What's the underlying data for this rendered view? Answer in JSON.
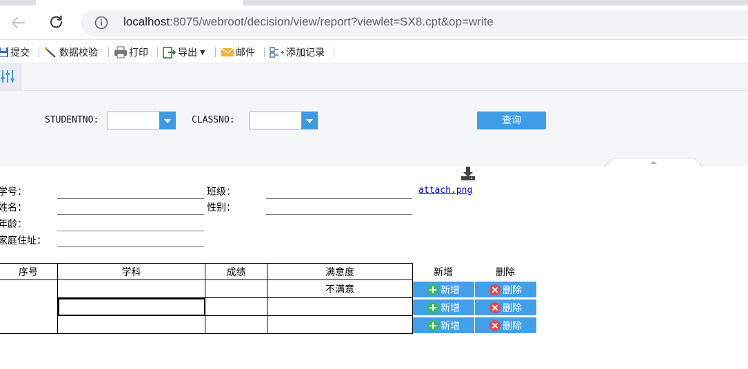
{
  "browser": {
    "url_host": "localhost",
    "url_path": ":8075/webroot/decision/view/report?viewlet=SX8.cpt&op=write"
  },
  "toolbar": {
    "submit": "提交",
    "verify": "数据校验",
    "print": "打印",
    "export": "导出",
    "mail": "邮件",
    "add_record": "添加记录"
  },
  "params": {
    "studentno_label": "STUDENTNO:",
    "studentno_value": "",
    "classno_label": "CLASSNO:",
    "classno_value": "",
    "query_button": "查询"
  },
  "form": {
    "attachment": "attach.png",
    "student_no_label": "学号：",
    "class_label": "班级：",
    "name_label": "姓名：",
    "gender_label": "性别：",
    "age_label": "年龄：",
    "address_label": "家庭住址："
  },
  "table": {
    "headers": [
      "序号",
      "学科",
      "成绩",
      "满意度"
    ],
    "rows": [
      {
        "index": "",
        "subject": "",
        "score": "",
        "satisfaction": "不满意"
      },
      {
        "index": "",
        "subject": "",
        "score": "",
        "satisfaction": ""
      },
      {
        "index": "",
        "subject": "",
        "score": "",
        "satisfaction": ""
      }
    ],
    "add_header": "新增",
    "delete_header": "删除",
    "add_button": "新增",
    "delete_button": "删除"
  },
  "colors": {
    "accent": "#3f9de8",
    "add_icon": "#3cba54",
    "delete_icon": "#e5484d",
    "link": "#0000ee"
  },
  "icons": [
    "back-arrow-icon",
    "reload-icon",
    "info-icon",
    "save-icon",
    "verify-icon",
    "print-icon",
    "export-icon",
    "mail-icon",
    "add-record-icon",
    "param-toggle-icon",
    "download-icon",
    "plus-icon",
    "delete-icon"
  ]
}
